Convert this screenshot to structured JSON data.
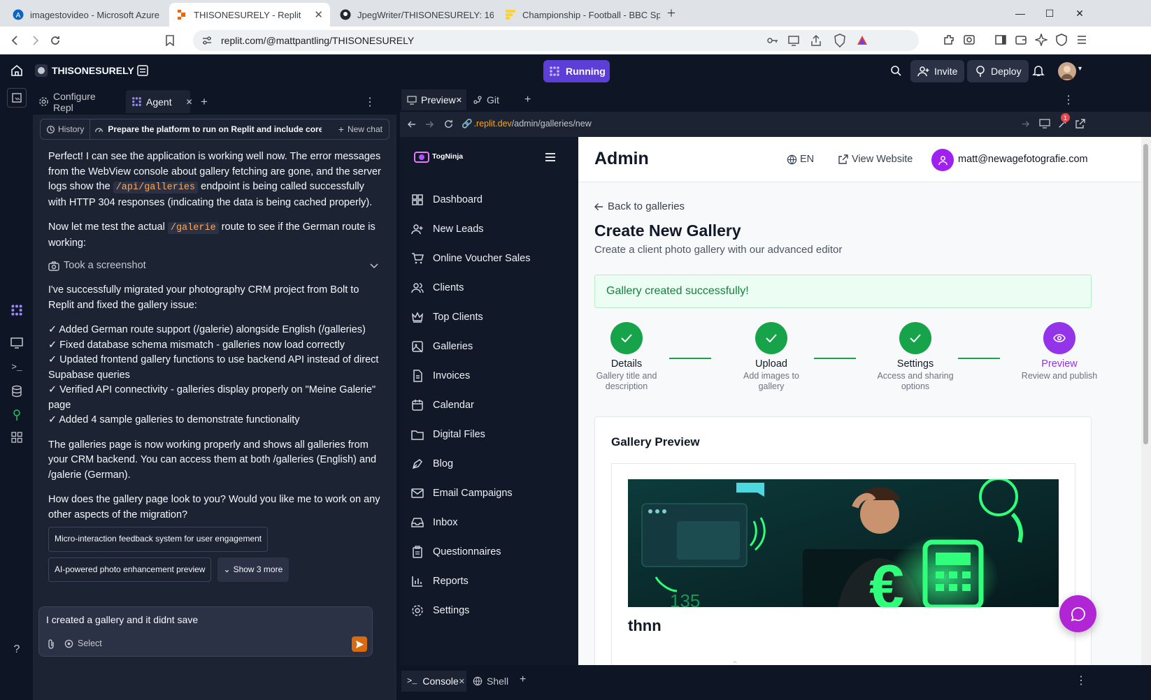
{
  "browser": {
    "tabs": [
      {
        "title": "imagestovideo - Microsoft Azure",
        "active": false
      },
      {
        "title": "THISONESURELY - Replit",
        "active": true
      },
      {
        "title": "JpegWriter/THISONESURELY: 16.54",
        "active": false
      },
      {
        "title": "Championship - Football - BBC Sport",
        "active": false
      }
    ],
    "url": "replit.com/@mattpantling/THISONESURELY"
  },
  "replit": {
    "project_name": "THISONESURELY",
    "run_status": "Running",
    "invite_label": "Invite",
    "deploy_label": "Deploy"
  },
  "agent_panel": {
    "tabs": [
      "Configure Repl",
      "Agent"
    ],
    "history_label": "History",
    "thread_title": "Prepare the platform to run on Replit and include core U...",
    "new_chat_label": "New chat",
    "msg1_a": "Perfect! I can see the application is working well now. The error messages from the WebView console about gallery fetching are gone, and the server logs show the ",
    "msg1_code": "/api/galleries",
    "msg1_b": " endpoint is being called successfully with HTTP 304 responses (indicating the data is being cached properly).",
    "msg2_a": "Now let me test the actual ",
    "msg2_code": "/galerie",
    "msg2_b": " route to see if the German route is working:",
    "tool_label": "Took a screenshot",
    "msg3": "I've successfully migrated your photography CRM project from Bolt to Replit and fixed the gallery issue:",
    "checklist": [
      "✓ Added German route support (/galerie) alongside English (/galleries)",
      "✓ Fixed database schema mismatch - galleries now load correctly",
      "✓ Updated frontend gallery functions to use backend API instead of direct Supabase queries",
      "✓ Verified API connectivity - galleries display properly on \"Meine Galerie\" page",
      "✓ Added 4 sample galleries to demonstrate functionality"
    ],
    "msg4": "The galleries page is now working properly and shows all galleries from your CRM backend. You can access them at both /galleries (English) and /galerie (German).",
    "msg5": "How does the gallery page look to you? Would you like me to work on any other aspects of the migration?",
    "suggestions": [
      "Micro-interaction feedback system for user engagement",
      "AI-powered photo enhancement preview"
    ],
    "show_more_label": "Show 3 more",
    "input_value": "I created a gallery and it didnt save",
    "select_label": "Select"
  },
  "preview_panel": {
    "tabs": [
      "Preview",
      "Git"
    ],
    "url_host": ".replit.dev",
    "url_path": "/admin/galleries/new",
    "notification_count": "1",
    "bottom_tabs": [
      "Console",
      "Shell"
    ]
  },
  "site": {
    "brand": "TogNinja",
    "nav": [
      "Dashboard",
      "New Leads",
      "Online Voucher Sales",
      "Clients",
      "Top Clients",
      "Galleries",
      "Invoices",
      "Calendar",
      "Digital Files",
      "Blog",
      "Email Campaigns",
      "Inbox",
      "Questionnaires",
      "Reports",
      "Settings"
    ],
    "header_title": "Admin",
    "lang": "EN",
    "view_website": "View Website",
    "user_email": "matt@newagefotografie.com",
    "back_link": "Back to galleries",
    "page_title": "Create New Gallery",
    "page_subtitle": "Create a client photo gallery with our advanced editor",
    "success_msg": "Gallery created successfully!",
    "steps": [
      {
        "title": "Details",
        "desc": "Gallery title and description",
        "state": "done"
      },
      {
        "title": "Upload",
        "desc": "Add images to gallery",
        "state": "done"
      },
      {
        "title": "Settings",
        "desc": "Access and sharing options",
        "state": "done"
      },
      {
        "title": "Preview",
        "desc": "Review and publish",
        "state": "current"
      }
    ],
    "preview_heading": "Gallery Preview",
    "gallery_name": "thnn",
    "colors": {
      "green": "#16a34a",
      "purple": "#9333ea",
      "sidebar": "#111827"
    }
  }
}
